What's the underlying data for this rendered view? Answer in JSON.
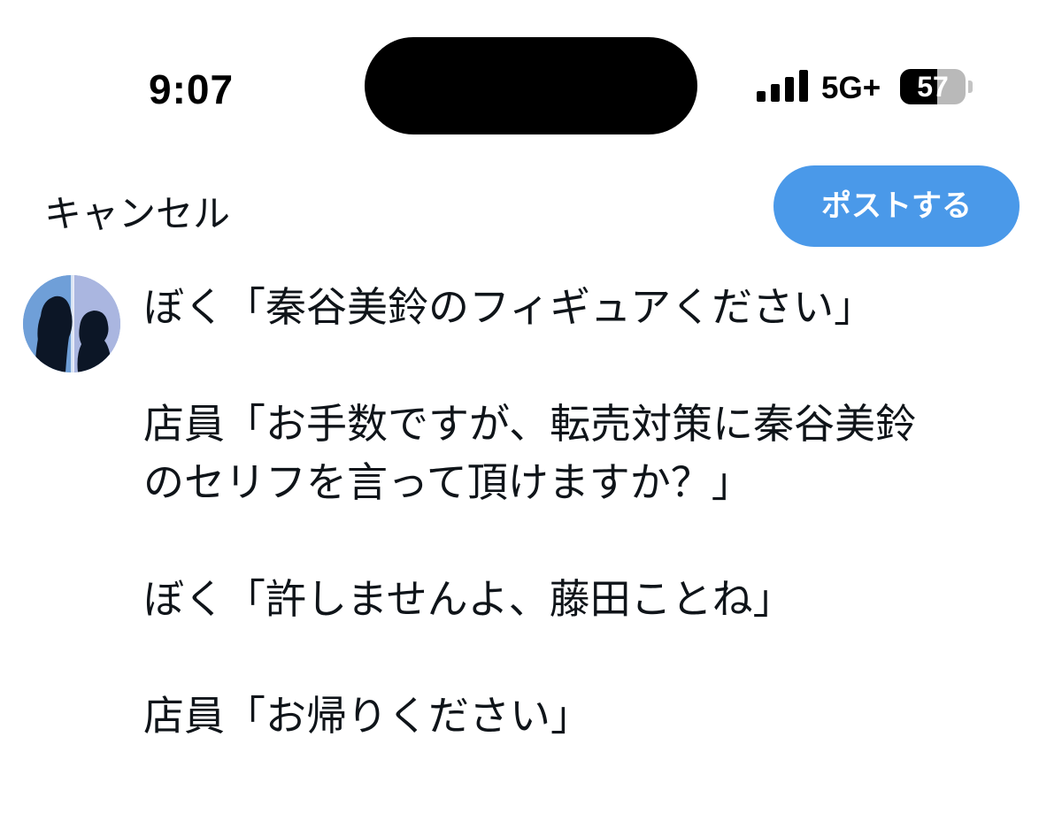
{
  "status_bar": {
    "time": "9:07",
    "network": "5G+",
    "battery_level": 57,
    "battery_text": "57",
    "signal_bars": 4
  },
  "compose": {
    "cancel_label": "キャンセル",
    "post_button_label": "ポストする",
    "post_button_color": "#4a99e9"
  },
  "post": {
    "lines": [
      "ぼく「秦谷美鈴のフィギュアください」",
      "店員「お手数ですが、転売対策に秦谷美鈴",
      "のセリフを言って頂けますか？」",
      "ぼく「許しませんよ、藤田ことね」",
      "店員「お帰りください」"
    ]
  },
  "avatar": {
    "icon": "two-silhouettes-avatar",
    "colors": {
      "left": "#6f9fd8",
      "right": "#aab6e0",
      "silhouette": "#0c1626"
    }
  }
}
